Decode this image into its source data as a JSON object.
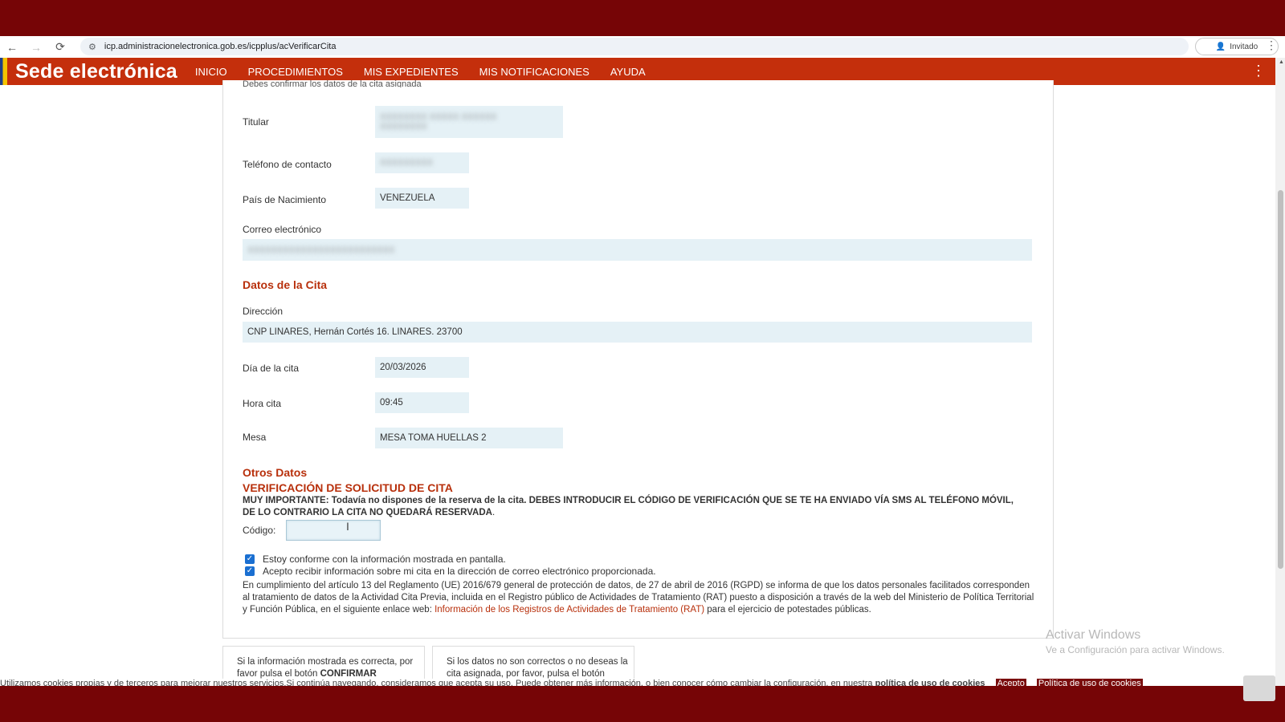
{
  "browser": {
    "url": "icp.administracionelectronica.gob.es/icpplus/acVerificarCita",
    "profile_label": "Invitado"
  },
  "site": {
    "title": "Sede electrónica",
    "menu": [
      "INICIO",
      "PROCEDIMIENTOS",
      "MIS EXPEDIENTES",
      "MIS NOTIFICACIONES",
      "AYUDA"
    ]
  },
  "intro_text": "Debes confirmar los datos de la cita asignada",
  "personal": {
    "titular_label": "Titular",
    "telefono_label": "Teléfono de contacto",
    "pais_label": "País de Nacimiento",
    "pais_value": "VENEZUELA",
    "correo_label": "Correo electrónico"
  },
  "cita": {
    "section_title": "Datos de la Cita",
    "direccion_label": "Dirección",
    "direccion_value": "CNP LINARES, Hernán Cortés 16. LINARES. 23700",
    "dia_label": "Día de la cita",
    "dia_value": "20/03/2026",
    "hora_label": "Hora cita",
    "hora_value": "09:45",
    "mesa_label": "Mesa",
    "mesa_value": "MESA TOMA HUELLAS 2"
  },
  "otros": {
    "section_title": "Otros Datos",
    "verif_title": "VERIFICACIÓN DE SOLICITUD DE CITA",
    "important_lead": "MUY IMPORTANTE:",
    "important_text": "Todavía no dispones de la reserva de la cita. DEBES INTRODUCIR EL CÓDIGO DE VERIFICACIÓN QUE SE TE HA ENVIADO VÍA SMS AL TELÉFONO MÓVIL, DE LO CONTRARIO LA CITA NO QUEDARÁ RESERVADA",
    "important_tail": ".",
    "codigo_label": "Código:",
    "check1": "Estoy conforme con la información mostrada en pantalla.",
    "check2": "Acepto recibir información sobre mi cita en la dirección de correo electrónico proporcionada.",
    "rgpd_pre": "En cumplimiento del artículo 13 del Reglamento (UE) 2016/679 general de protección de datos, de 27 de abril de 2016 (RGPD) se informa de que los datos personales facilitados corresponden al tratamiento de datos de la Actividad Cita Previa, incluida en el Registro público de Actividades de Tratamiento (RAT) puesto a disposición a través de la web del Ministerio de Política Territorial y Función Pública, en el siguiente enlace web: ",
    "rgpd_link": "Información de los Registros de Actividades de Tratamiento (RAT)",
    "rgpd_post": " para el ejercicio de potestades públicas."
  },
  "bottom": {
    "confirm_text": "Si la información mostrada es correcta, por favor pulsa el botón ",
    "confirm_strong": "CONFIRMAR",
    "cancel_text": "Si los datos no son correctos o no deseas la cita asignada, por favor, pulsa el botón"
  },
  "cookies": {
    "text": "Utilizamos cookies propias y de terceros para mejorar nuestros servicios.Si continúa navegando, consideramos que acepta su uso. Puede obtener más información, o bien conocer cómo cambiar la configuración, en nuestra ",
    "policy_strong": "política de uso de cookies",
    "accept": "Acepto",
    "policy_btn": "Política de uso de cookies"
  },
  "watermark": {
    "line1": "Activar Windows",
    "line2": "Ve a Configuración para activar Windows."
  }
}
